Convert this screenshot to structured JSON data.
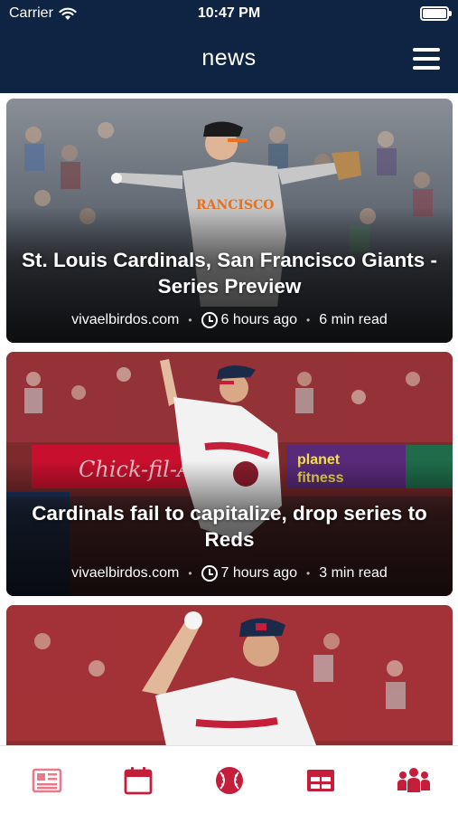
{
  "status_bar": {
    "carrier": "Carrier",
    "time": "10:47 PM"
  },
  "header": {
    "title": "news"
  },
  "articles": [
    {
      "title": "St. Louis Cardinals, San Francisco Giants - Series Preview",
      "source": "vivaelbirdos.com",
      "time_ago": "6 hours ago",
      "read_time": "6 min read"
    },
    {
      "title": "Cardinals fail to capitalize, drop series to Reds",
      "source": "vivaelbirdos.com",
      "time_ago": "7 hours ago",
      "read_time": "3 min read"
    },
    {
      "title": "",
      "source": "",
      "time_ago": "",
      "read_time": ""
    }
  ],
  "tabs": [
    {
      "icon": "newspaper-icon",
      "active": true
    },
    {
      "icon": "calendar-icon",
      "active": false
    },
    {
      "icon": "baseball-icon",
      "active": false
    },
    {
      "icon": "standings-table-icon",
      "active": false
    },
    {
      "icon": "team-roster-icon",
      "active": false
    }
  ],
  "colors": {
    "navy": "#0f2442",
    "cardinal_red": "#c41e3a",
    "tab_inactive": "#c41e3a",
    "tab_active": "#e87a8a"
  }
}
